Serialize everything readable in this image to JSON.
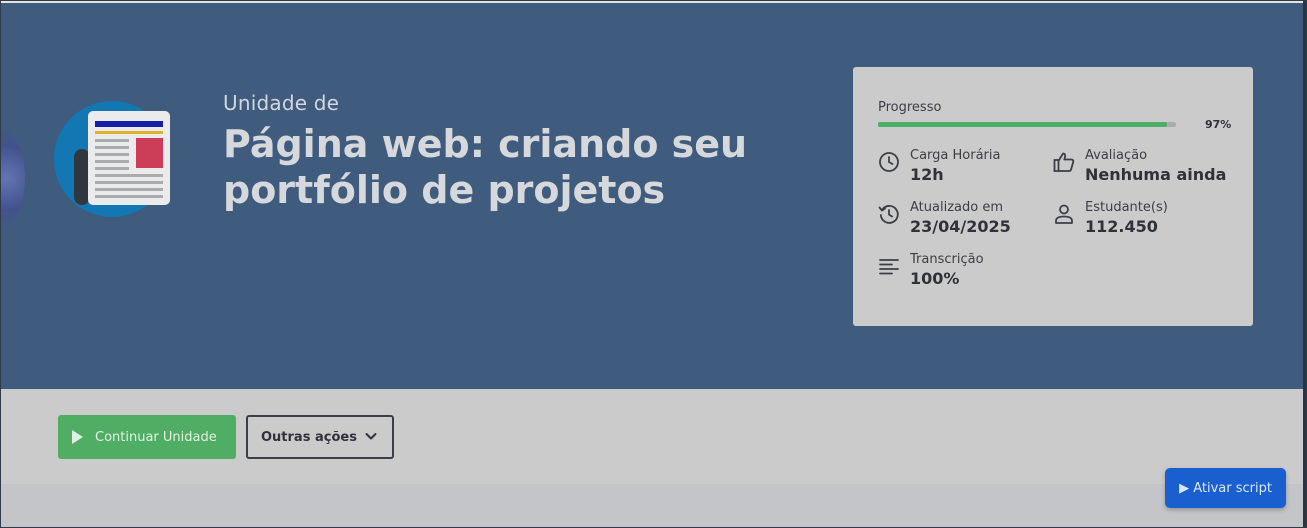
{
  "hero": {
    "kicker": "Unidade de",
    "title": "Página web: criando seu portfólio de projetos",
    "background_color": "#3f5c7e"
  },
  "progress": {
    "label": "Progresso",
    "percent_text": "97%",
    "value": 0.97,
    "bar_color": "#4caf68"
  },
  "stats": [
    {
      "icon": "clock-icon",
      "label": "Carga Horária",
      "value": "12h"
    },
    {
      "icon": "thumbs-up-icon",
      "label": "Avaliação",
      "value": "Nenhuma ainda"
    },
    {
      "icon": "history-icon",
      "label": "Atualizado em",
      "value": "23/04/2025"
    },
    {
      "icon": "person-icon",
      "label": "Estudante(s)",
      "value": "112.450"
    },
    {
      "icon": "transcript-lines-icon",
      "label": "Transcrição",
      "value": "100%"
    }
  ],
  "actions": {
    "continue_label": "Continuar Unidade",
    "continue_color": "#4fae64",
    "more_label": "Outras ações"
  },
  "floating": {
    "script_label": "▶ Ativar script",
    "script_color": "#1a5fd0"
  }
}
